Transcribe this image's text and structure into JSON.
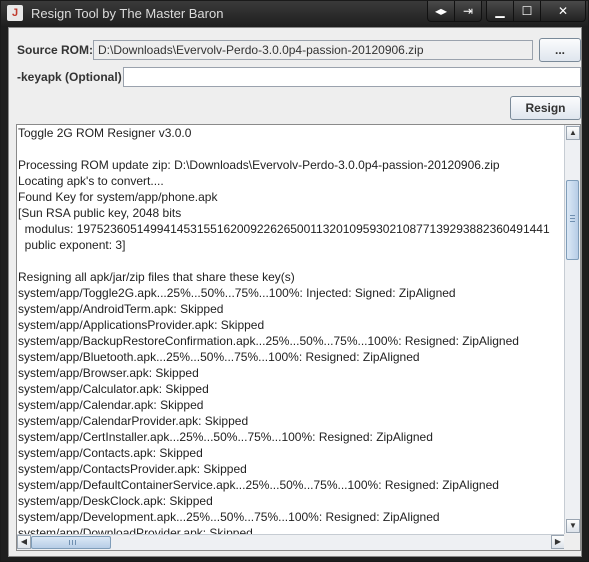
{
  "window": {
    "title": "Resign Tool by The Master Baron",
    "app_icon": "java-cup-icon"
  },
  "form": {
    "source_rom_label": "Source ROM:",
    "source_rom_value": "D:\\Downloads\\Evervolv-Perdo-3.0.0p4-passion-20120906.zip",
    "browse_label": "...",
    "keyapk_label": "-keyapk (Optional)",
    "keyapk_value": "",
    "resign_label": "Resign"
  },
  "log": {
    "lines": [
      "Toggle 2G ROM Resigner v3.0.0",
      "",
      "Processing ROM update zip: D:\\Downloads\\Evervolv-Perdo-3.0.0p4-passion-20120906.zip",
      "Locating apk's to convert....",
      "Found Key for system/app/phone.apk",
      "[Sun RSA public key, 2048 bits",
      "  modulus: 19752360514994145315516200922626500113201095930210877139293882360491441",
      "  public exponent: 3]",
      "",
      "Resigning all apk/jar/zip files that share these key(s)",
      "system/app/Toggle2G.apk...25%...50%...75%...100%: Injected: Signed: ZipAligned",
      "system/app/AndroidTerm.apk: Skipped",
      "system/app/ApplicationsProvider.apk: Skipped",
      "system/app/BackupRestoreConfirmation.apk...25%...50%...75%...100%: Resigned: ZipAligned",
      "system/app/Bluetooth.apk...25%...50%...75%...100%: Resigned: ZipAligned",
      "system/app/Browser.apk: Skipped",
      "system/app/Calculator.apk: Skipped",
      "system/app/Calendar.apk: Skipped",
      "system/app/CalendarProvider.apk: Skipped",
      "system/app/CertInstaller.apk...25%...50%...75%...100%: Resigned: ZipAligned",
      "system/app/Contacts.apk: Skipped",
      "system/app/ContactsProvider.apk: Skipped",
      "system/app/DefaultContainerService.apk...25%...50%...75%...100%: Resigned: ZipAligned",
      "system/app/DeskClock.apk: Skipped",
      "system/app/Development.apk...25%...50%...75%...100%: Resigned: ZipAligned",
      "system/app/DownloadProvider.apk: Skipped"
    ]
  }
}
